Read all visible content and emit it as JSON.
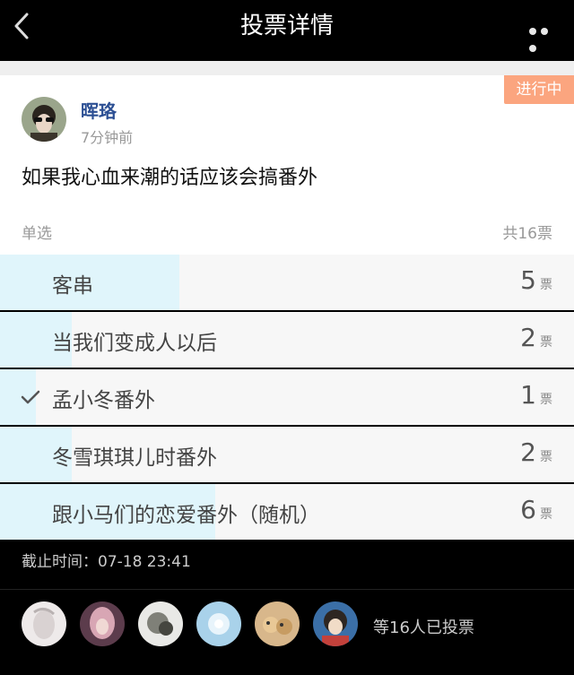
{
  "header": {
    "title": "投票详情",
    "back_icon": "chevron-left-icon",
    "more_icon": "more-horizontal-icon"
  },
  "post": {
    "status": "进行中",
    "author": "晖珞",
    "time": "7分钟前",
    "question": "如果我心血来潮的话应该会搞番外",
    "type": "单选",
    "total": "共16票"
  },
  "options": [
    {
      "label": "客串",
      "votes": "5",
      "unit": "票",
      "share": 0.3125,
      "selected": false
    },
    {
      "label": "当我们变成人以后",
      "votes": "2",
      "unit": "票",
      "share": 0.125,
      "selected": false
    },
    {
      "label": "孟小冬番外",
      "votes": "1",
      "unit": "票",
      "share": 0.0625,
      "selected": true
    },
    {
      "label": "冬雪琪琪儿时番外",
      "votes": "2",
      "unit": "票",
      "share": 0.125,
      "selected": false
    },
    {
      "label": "跟小马们的恋爱番外（随机）",
      "votes": "6",
      "unit": "票",
      "share": 0.375,
      "selected": false
    }
  ],
  "footer": {
    "deadline": "截止时间：07-18 23:41",
    "voted": "等16人已投票"
  },
  "colors": {
    "accent_fill": "#e0f5fb",
    "status_bg": "#fba57f",
    "author": "#2c4f93"
  }
}
